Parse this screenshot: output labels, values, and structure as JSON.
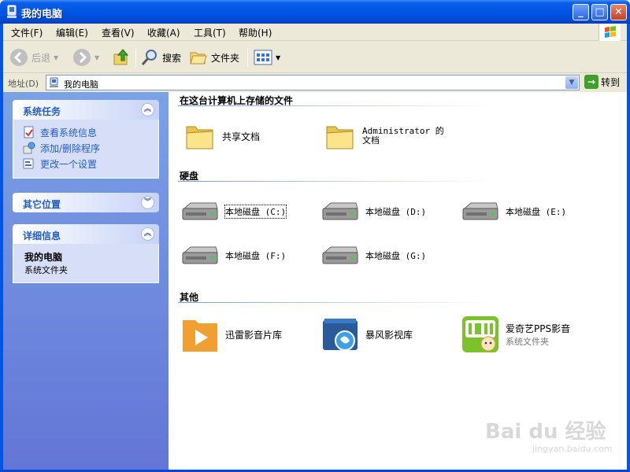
{
  "window": {
    "title": "我的电脑",
    "minimize": "_",
    "maximize": "□",
    "close": "✕"
  },
  "menu": [
    "文件(F)",
    "编辑(E)",
    "查看(V)",
    "收藏(A)",
    "工具(T)",
    "帮助(H)"
  ],
  "toolbar": {
    "back": "后退",
    "search": "搜索",
    "folders": "文件夹"
  },
  "address": {
    "label": "地址(D)",
    "value": "我的电脑",
    "go": "转到"
  },
  "left": {
    "system_tasks": {
      "title": "系统任务",
      "items": [
        "查看系统信息",
        "添加/删除程序",
        "更改一个设置"
      ]
    },
    "other_places": {
      "title": "其它位置"
    },
    "details": {
      "title": "详细信息",
      "name": "我的电脑",
      "desc": "系统文件夹"
    }
  },
  "right": {
    "stored_files": {
      "title": "在这台计算机上存储的文件",
      "items": [
        "共享文档",
        "Administrator 的文档"
      ]
    },
    "hard_disks": {
      "title": "硬盘",
      "items": [
        "本地磁盘 (C:)",
        "本地磁盘 (D:)",
        "本地磁盘 (E:)",
        "本地磁盘 (F:)",
        "本地磁盘 (G:)"
      ]
    },
    "other": {
      "title": "其他",
      "items": [
        {
          "name": "迅雷影音片库",
          "sub": ""
        },
        {
          "name": "暴风影视库",
          "sub": ""
        },
        {
          "name": "爱奇艺PPS影音",
          "sub": "系统文件夹"
        }
      ]
    }
  },
  "watermark": {
    "logo": "Bai du 经验",
    "url": "jingyan.baidu.com"
  }
}
